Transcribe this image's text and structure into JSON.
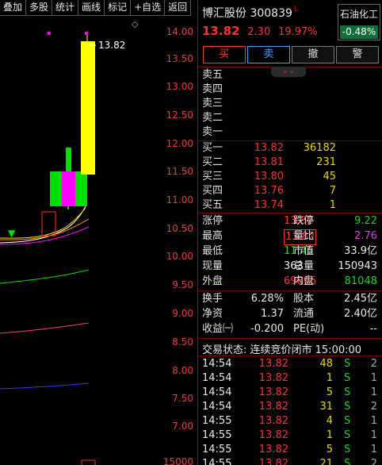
{
  "toolbar": [
    "叠加",
    "多股",
    "统计",
    "画线",
    "标记",
    "+自选",
    "返回"
  ],
  "chart": {
    "axis_labels": [
      "14.00",
      "13.50",
      "13.00",
      "12.50",
      "12.00",
      "11.50",
      "11.00",
      "10.50",
      "10.00",
      "9.50",
      "9.00",
      "8.50",
      "8.00",
      "7.50",
      "7.00",
      "15000"
    ],
    "last_price_label": "13.82",
    "colors": {
      "up": "#ffff00",
      "up2": "#ff00ff",
      "down": "#00ff00",
      "ma1": "#ffffff",
      "ma2": "#ffd800",
      "ma3": "#ff00ff",
      "ma4": "#00ff00",
      "ma5": "#ff3399",
      "ma6": "#3333ff"
    }
  },
  "stock": {
    "name_code": "博汇股份 300839",
    "mark": "L",
    "price": "13.82",
    "change": "2.30",
    "change_pct": "19.97%"
  },
  "sector": {
    "name": "石油化工",
    "pct": "-0.48%"
  },
  "actions": [
    "买",
    "卖",
    "撤",
    "警"
  ],
  "order_book": {
    "asks": [
      {
        "label": "卖五",
        "price": "",
        "vol": ""
      },
      {
        "label": "卖四",
        "price": "",
        "vol": ""
      },
      {
        "label": "卖三",
        "price": "",
        "vol": ""
      },
      {
        "label": "卖二",
        "price": "",
        "vol": ""
      },
      {
        "label": "卖一",
        "price": "",
        "vol": ""
      }
    ],
    "bids": [
      {
        "label": "买一",
        "price": "13.82",
        "vol": "36182"
      },
      {
        "label": "买二",
        "price": "13.81",
        "vol": "231"
      },
      {
        "label": "买三",
        "price": "13.80",
        "vol": "45"
      },
      {
        "label": "买四",
        "price": "13.76",
        "vol": "7"
      },
      {
        "label": "买五",
        "price": "13.74",
        "vol": "1"
      }
    ]
  },
  "stats": [
    {
      "l1": "涨停",
      "v1": "13.82",
      "c1": "red",
      "l2": "跌停",
      "v2": "9.22",
      "c2": "green"
    },
    {
      "l1": "最高",
      "v1": "13.82",
      "c1": "red box",
      "l2": "量比",
      "v2": "2.76",
      "c2": "magenta"
    },
    {
      "l1": "最低",
      "v1": "11.45",
      "c1": "green",
      "l2": "市值",
      "v2": "33.9亿",
      "c2": "white"
    },
    {
      "l1": "现量",
      "v1": "363",
      "c1": "white",
      "l2": "总量",
      "v2": "150943",
      "c2": "white"
    },
    {
      "l1": "外盘",
      "v1": "69895",
      "c1": "red",
      "l2": "内盘",
      "v2": "81048",
      "c2": "green"
    }
  ],
  "stats2": [
    {
      "l1": "换手",
      "v1": "6.28%",
      "l2": "股本",
      "v2": "2.45亿"
    },
    {
      "l1": "净资",
      "v1": "1.37",
      "l2": "流通",
      "v2": "2.40亿"
    },
    {
      "l1": "收益㈠",
      "v1": "-0.200",
      "l2": "PE(动)",
      "v2": "--"
    }
  ],
  "trade_status": "交易状态: 连续竞价闭市 15:00:00",
  "ticks": [
    {
      "time": "14:54",
      "price": "13.82",
      "vol": "48",
      "side": "S",
      "n": "2"
    },
    {
      "time": "14:54",
      "price": "13.82",
      "vol": "1",
      "side": "S",
      "n": "1"
    },
    {
      "time": "14:54",
      "price": "13.82",
      "vol": "5",
      "side": "S",
      "n": "1"
    },
    {
      "time": "14:54",
      "price": "13.82",
      "vol": "31",
      "side": "S",
      "n": "2"
    },
    {
      "time": "14:55",
      "price": "13.82",
      "vol": "4",
      "side": "S",
      "n": "1"
    },
    {
      "time": "14:55",
      "price": "13.82",
      "vol": "1",
      "side": "S",
      "n": "1"
    },
    {
      "time": "14:55",
      "price": "13.82",
      "vol": "5",
      "side": "S",
      "n": "1"
    },
    {
      "time": "14:55",
      "price": "13.82",
      "vol": "21",
      "side": "S",
      "n": "2"
    }
  ]
}
